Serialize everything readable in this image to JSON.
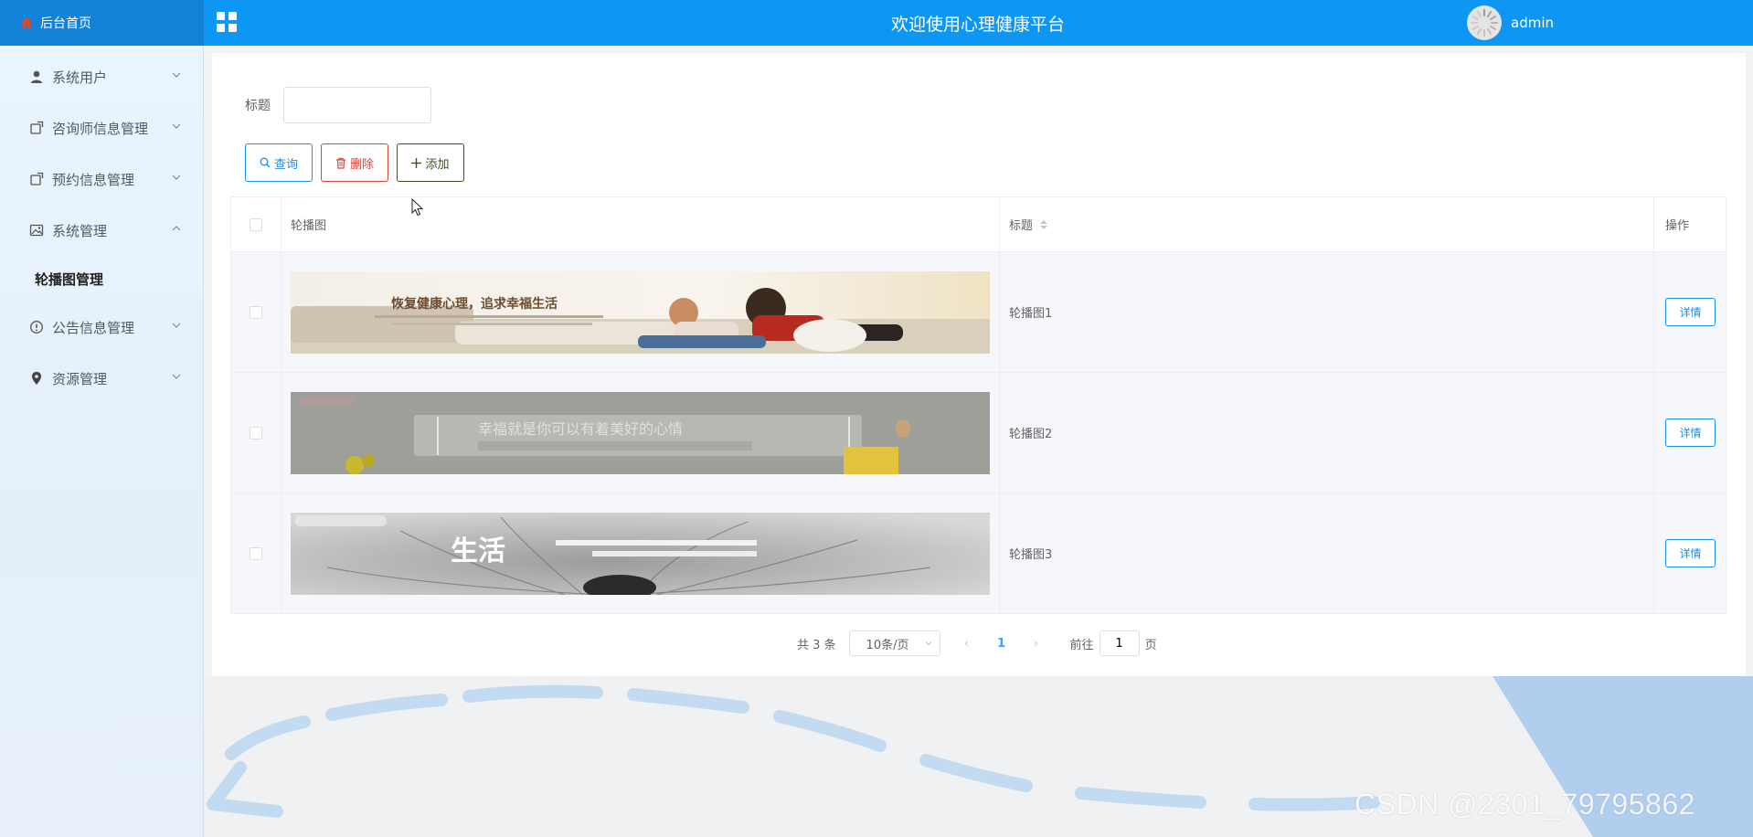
{
  "header": {
    "home_label": "后台首页",
    "title": "欢迎使用心理健康平台",
    "username": "admin",
    "bg_color": "#0d96f2"
  },
  "sidebar": {
    "items": [
      {
        "label": "系统用户",
        "icon": "user-icon",
        "expanded": false
      },
      {
        "label": "咨询师信息管理",
        "icon": "external-link-icon",
        "expanded": false
      },
      {
        "label": "预约信息管理",
        "icon": "external-link-icon",
        "expanded": false
      },
      {
        "label": "系统管理",
        "icon": "picture-icon",
        "expanded": true,
        "children": [
          {
            "label": "轮播图管理",
            "active": true
          }
        ]
      },
      {
        "label": "公告信息管理",
        "icon": "info-icon",
        "expanded": false
      },
      {
        "label": "资源管理",
        "icon": "location-icon",
        "expanded": false
      }
    ]
  },
  "search": {
    "label": "标题",
    "value": "",
    "placeholder": ""
  },
  "buttons": {
    "query": "查询",
    "delete": "删除",
    "add": "添加"
  },
  "table": {
    "columns": [
      "轮播图",
      "标题",
      "操作"
    ],
    "rows": [
      {
        "title": "轮播图1",
        "action": "详情",
        "banner_text": "恢复健康心理，追求幸福生活"
      },
      {
        "title": "轮播图2",
        "action": "详情",
        "banner_text": "幸福就是你可以有着美好的心情"
      },
      {
        "title": "轮播图3",
        "action": "详情",
        "banner_text": "生活"
      }
    ]
  },
  "pagination": {
    "total": "共 3 条",
    "page_size": "10条/页",
    "current_page": "1",
    "goto_prefix": "前往",
    "goto_value": "1",
    "goto_suffix": "页"
  },
  "watermark": "CSDN @2301_79795862",
  "colors": {
    "primary": "#1d8ee6",
    "danger": "#d8473a",
    "add": "#3b5227",
    "sidebar_bg": "#eaf4fd"
  }
}
